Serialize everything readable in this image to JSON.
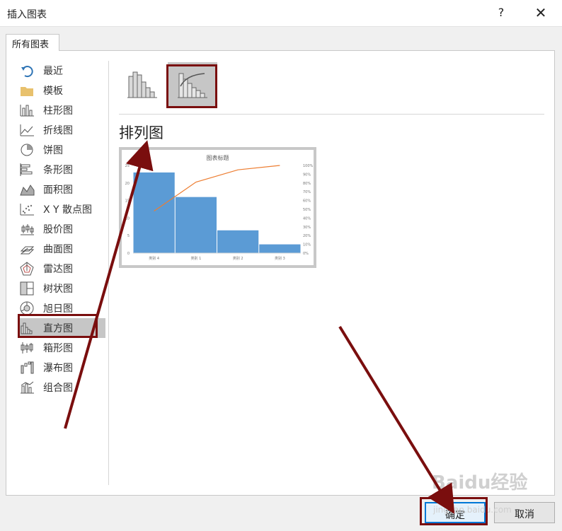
{
  "window": {
    "title": "插入图表",
    "help": "?",
    "close": "✕"
  },
  "tab": {
    "label": "所有图表"
  },
  "sidebar": {
    "items": [
      {
        "label": "最近",
        "icon": "recent-icon"
      },
      {
        "label": "模板",
        "icon": "folder-icon"
      },
      {
        "label": "柱形图",
        "icon": "column-chart-icon"
      },
      {
        "label": "折线图",
        "icon": "line-chart-icon"
      },
      {
        "label": "饼图",
        "icon": "pie-chart-icon"
      },
      {
        "label": "条形图",
        "icon": "bar-chart-icon"
      },
      {
        "label": "面积图",
        "icon": "area-chart-icon"
      },
      {
        "label": "X Y 散点图",
        "icon": "scatter-chart-icon"
      },
      {
        "label": "股价图",
        "icon": "stock-chart-icon"
      },
      {
        "label": "曲面图",
        "icon": "surface-chart-icon"
      },
      {
        "label": "雷达图",
        "icon": "radar-chart-icon"
      },
      {
        "label": "树状图",
        "icon": "treemap-chart-icon"
      },
      {
        "label": "旭日图",
        "icon": "sunburst-chart-icon"
      },
      {
        "label": "直方图",
        "icon": "histogram-chart-icon"
      },
      {
        "label": "箱形图",
        "icon": "box-whisker-chart-icon"
      },
      {
        "label": "瀑布图",
        "icon": "waterfall-chart-icon"
      },
      {
        "label": "组合图",
        "icon": "combo-chart-icon"
      }
    ],
    "selected_index": 13
  },
  "subtypes": {
    "selected_index": 1
  },
  "main": {
    "heading": "排列图"
  },
  "preview": {
    "chart_data": {
      "type": "bar",
      "title": "图表标题",
      "categories": [
        "类别 4",
        "类别 1",
        "类别 2",
        "类别 3"
      ],
      "values": [
        23,
        16,
        6.5,
        2.5
      ],
      "ylim": [
        0,
        25
      ],
      "yticks": [
        "0",
        "5",
        "10",
        "15",
        "20",
        "25"
      ],
      "y2ticks": [
        "0%",
        "10%",
        "20%",
        "30%",
        "40%",
        "50%",
        "60%",
        "70%",
        "80%",
        "90%",
        "100%"
      ],
      "cumulative_percent": [
        48,
        81,
        95,
        100
      ],
      "bar_color": "#5b9bd5",
      "line_color": "#ed7d31"
    }
  },
  "footer": {
    "ok_label": "确定",
    "cancel_label": "取消"
  },
  "watermark": {
    "text": "Baidu经验",
    "sub": "jingyan.baidu.com"
  },
  "annotation_color": "#7a0e0e"
}
